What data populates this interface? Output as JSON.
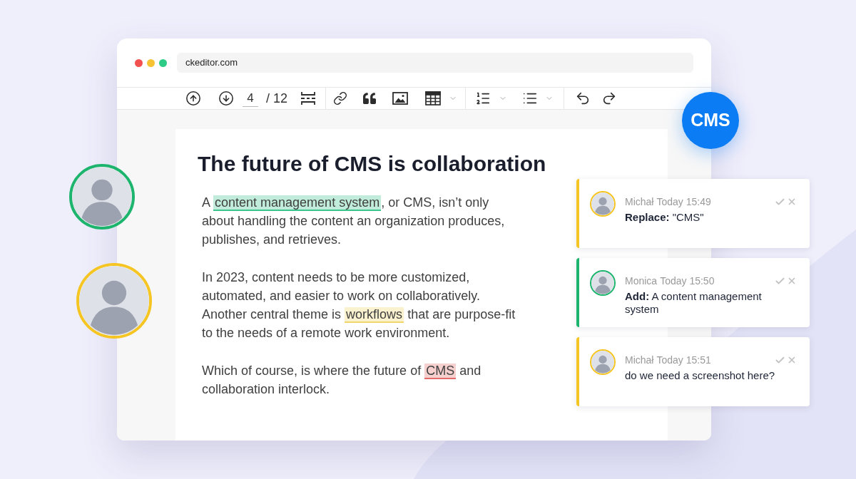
{
  "browser": {
    "address": "ckeditor.com"
  },
  "toolbar": {
    "page": "4",
    "page_total": "/ 12"
  },
  "badge": {
    "label": "CMS"
  },
  "collaborators": [
    {
      "color": "#1db56e"
    },
    {
      "color": "#f5c524"
    }
  ],
  "document": {
    "title": "The future of CMS is collaboration",
    "paragraphs": [
      [
        {
          "text": "A "
        },
        {
          "text": "content management system",
          "color": "#3cc48f"
        },
        {
          "text": ", or CMS, isn’t only about handling the content an organization produces, publishes, and retrieves."
        }
      ],
      [
        {
          "text": "In 2023, content needs to be more customized, automated, and easier to work on collaboratively. Another central theme is "
        },
        {
          "text": "workflows",
          "color": "#f0d66a"
        },
        {
          "text": " that are purpose-fit to the needs of a remote work environment."
        }
      ],
      [
        {
          "text": "Which of course, is where the future of "
        },
        {
          "text": "CMS",
          "color": "#e36a6a"
        },
        {
          "text": " and collaboration interlock."
        }
      ]
    ]
  },
  "comments": [
    {
      "author": "Michał",
      "time": "Today 15:49",
      "body": "**Replace:** \"CMS\"",
      "color": "#f5c524"
    },
    {
      "author": "Monica",
      "time": "Today 15:50",
      "body": "**Add:** A content management system",
      "color": "#1db56e"
    },
    {
      "author": "Michał",
      "time": "Today 15:51",
      "body": "do we need a screenshot here?",
      "color": "#f5c524"
    }
  ]
}
